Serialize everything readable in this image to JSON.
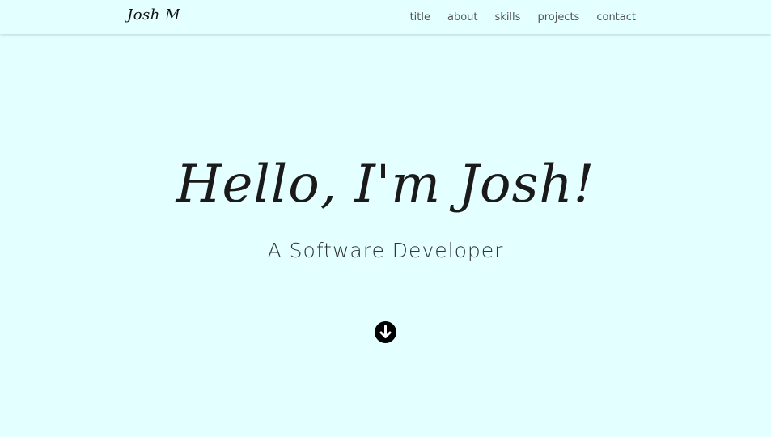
{
  "navbar": {
    "brand": "Josh M",
    "links": [
      "title",
      "about",
      "skills",
      "projects",
      "contact"
    ]
  },
  "hero": {
    "title": "Hello, I'm Josh!",
    "subtitle": "A Software Developer"
  },
  "icons": {
    "scroll_down": "arrow-down-circle-icon"
  },
  "colors": {
    "background": "#e3ffff",
    "text": "#1a1a1a",
    "nav_text": "#555555"
  }
}
